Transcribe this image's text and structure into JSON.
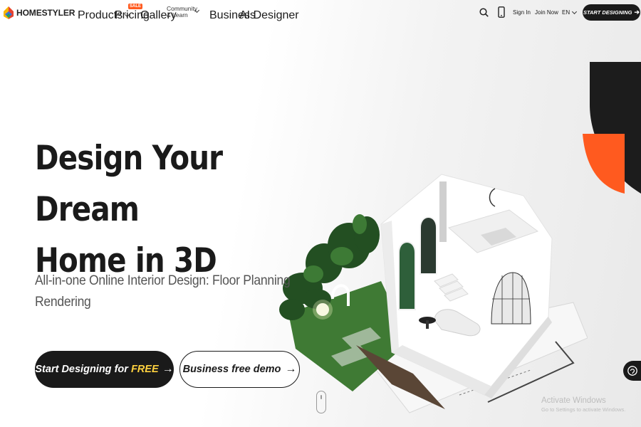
{
  "brand": {
    "name": "HOMESTYLER"
  },
  "nav": {
    "products": "Products",
    "pricing": "Pricing",
    "sale_badge": "SALE",
    "gallery": "Gallery",
    "community_line1": "Community",
    "community_line2": "& Learn",
    "business": "Business",
    "ai_designer": "AI Designer"
  },
  "header_right": {
    "sign_in": "Sign In",
    "join_now": "Join Now",
    "language": "EN",
    "cta": "START DESIGNING"
  },
  "hero": {
    "title_line1": "Design Your Dream",
    "title_line2": "Home in 3D",
    "subtitle_line1": "All-in-one Online Interior Design: Floor Planning",
    "subtitle_line2": "Rendering",
    "primary_button_prefix": "Start Designing for ",
    "primary_button_highlight": "FREE",
    "secondary_button": "Business free demo"
  },
  "watermark": {
    "line1": "Activate Windows",
    "line2": "Go to Settings to activate Windows."
  },
  "icons": [
    "logo-icon",
    "search-icon",
    "phone-icon",
    "chevron-down-icon",
    "arrow-right-icon",
    "help-icon",
    "scroll-mouse-icon"
  ],
  "colors": {
    "dark": "#1a1a1a",
    "accent_orange": "#ff5a1f",
    "highlight_yellow": "#ffd23f"
  }
}
